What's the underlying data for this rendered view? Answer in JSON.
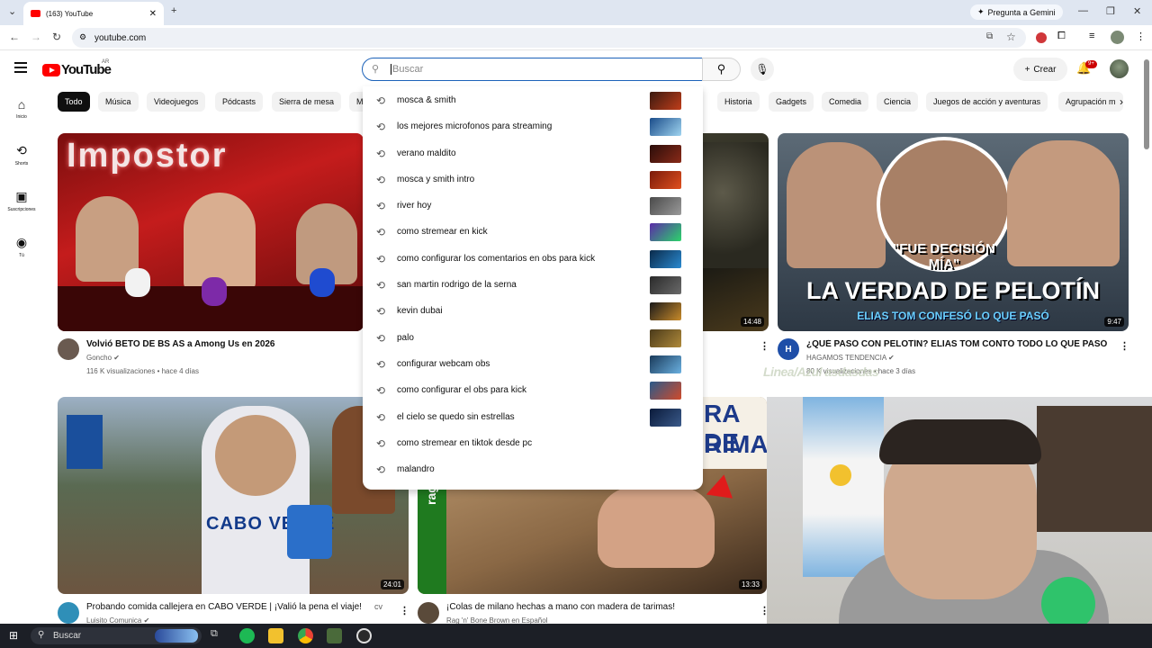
{
  "browser": {
    "tab_title": "(163) YouTube",
    "gemini_label": "Pregunta a Gemini",
    "url": "youtube.com"
  },
  "header": {
    "logo_text": "YouTube",
    "country": "AR",
    "search_placeholder": "Buscar",
    "create_label": "Crear",
    "notifications_badge": "9+"
  },
  "sidebar": {
    "items": [
      {
        "label": "Inicio",
        "icon": "home-icon"
      },
      {
        "label": "Shorts",
        "icon": "shorts-icon"
      },
      {
        "label": "Suscripciones",
        "icon": "subscriptions-icon"
      },
      {
        "label": "Tú",
        "icon": "you-icon"
      }
    ]
  },
  "chips": [
    "Todo",
    "Música",
    "Videojuegos",
    "Pódcasts",
    "Sierra de mesa",
    "M",
    "Historia",
    "Gadgets",
    "Comedia",
    "Ciencia",
    "Juegos de acción y aventuras",
    "Agrupación m"
  ],
  "suggestions": [
    "mosca & smith",
    "los mejores microfonos para streaming",
    "verano maldito",
    "mosca y smith intro",
    "river hoy",
    "como stremear en kick",
    "como configurar los comentarios en obs para kick",
    "san martin rodrigo de la serna",
    "kevin dubai",
    "palo",
    "configurar webcam obs",
    "como configurar el obs para kick",
    "el cielo se quedo sin estrellas",
    "como stremear en tiktok desde pc",
    "malandro"
  ],
  "videos": [
    {
      "title": "Volvió BETO DE BS AS a Among Us en 2026",
      "channel": "Goncho",
      "meta": "116 K visualizaciones • hace 4 días",
      "thumb_text": "Impostor"
    },
    {
      "duration": "14:48"
    },
    {
      "title": "¿QUÉ PASÓ CON PELOTÍN? ELIAS TOM CONTÓ TODO LO QUE PASÓ",
      "channel": "HAGAMOS TENDENCIA",
      "meta": "80 K visualizaciones • hace 3 días",
      "duration": "9:47",
      "thumb_line1": "\"FUE DECISIÓN MÍA\"",
      "thumb_line2": "LA VERDAD DE PELOTÍN",
      "thumb_line3": "ELIAS TOM CONFESÓ LO QUE PASÓ"
    },
    {
      "title": "Probando comida callejera en CABO VERDE | ¡Valió la pena el viaje!",
      "channel": "Luisito Comunica",
      "duration": "24:01",
      "thumb_text": "CABO VERDE"
    },
    {
      "title": "¡Colas de milano hechas a mano con madera de tarimas!",
      "channel": "Rag 'n' Bone Brown en Español",
      "duration": "13:33",
      "thumb_text1": "RA DE",
      "thumb_text2": "RIMA",
      "thumb_side": "rag 'n' bone"
    }
  ],
  "overlay_text": "Linea/Azul asdasdas",
  "taskbar": {
    "search_label": "Buscar"
  }
}
